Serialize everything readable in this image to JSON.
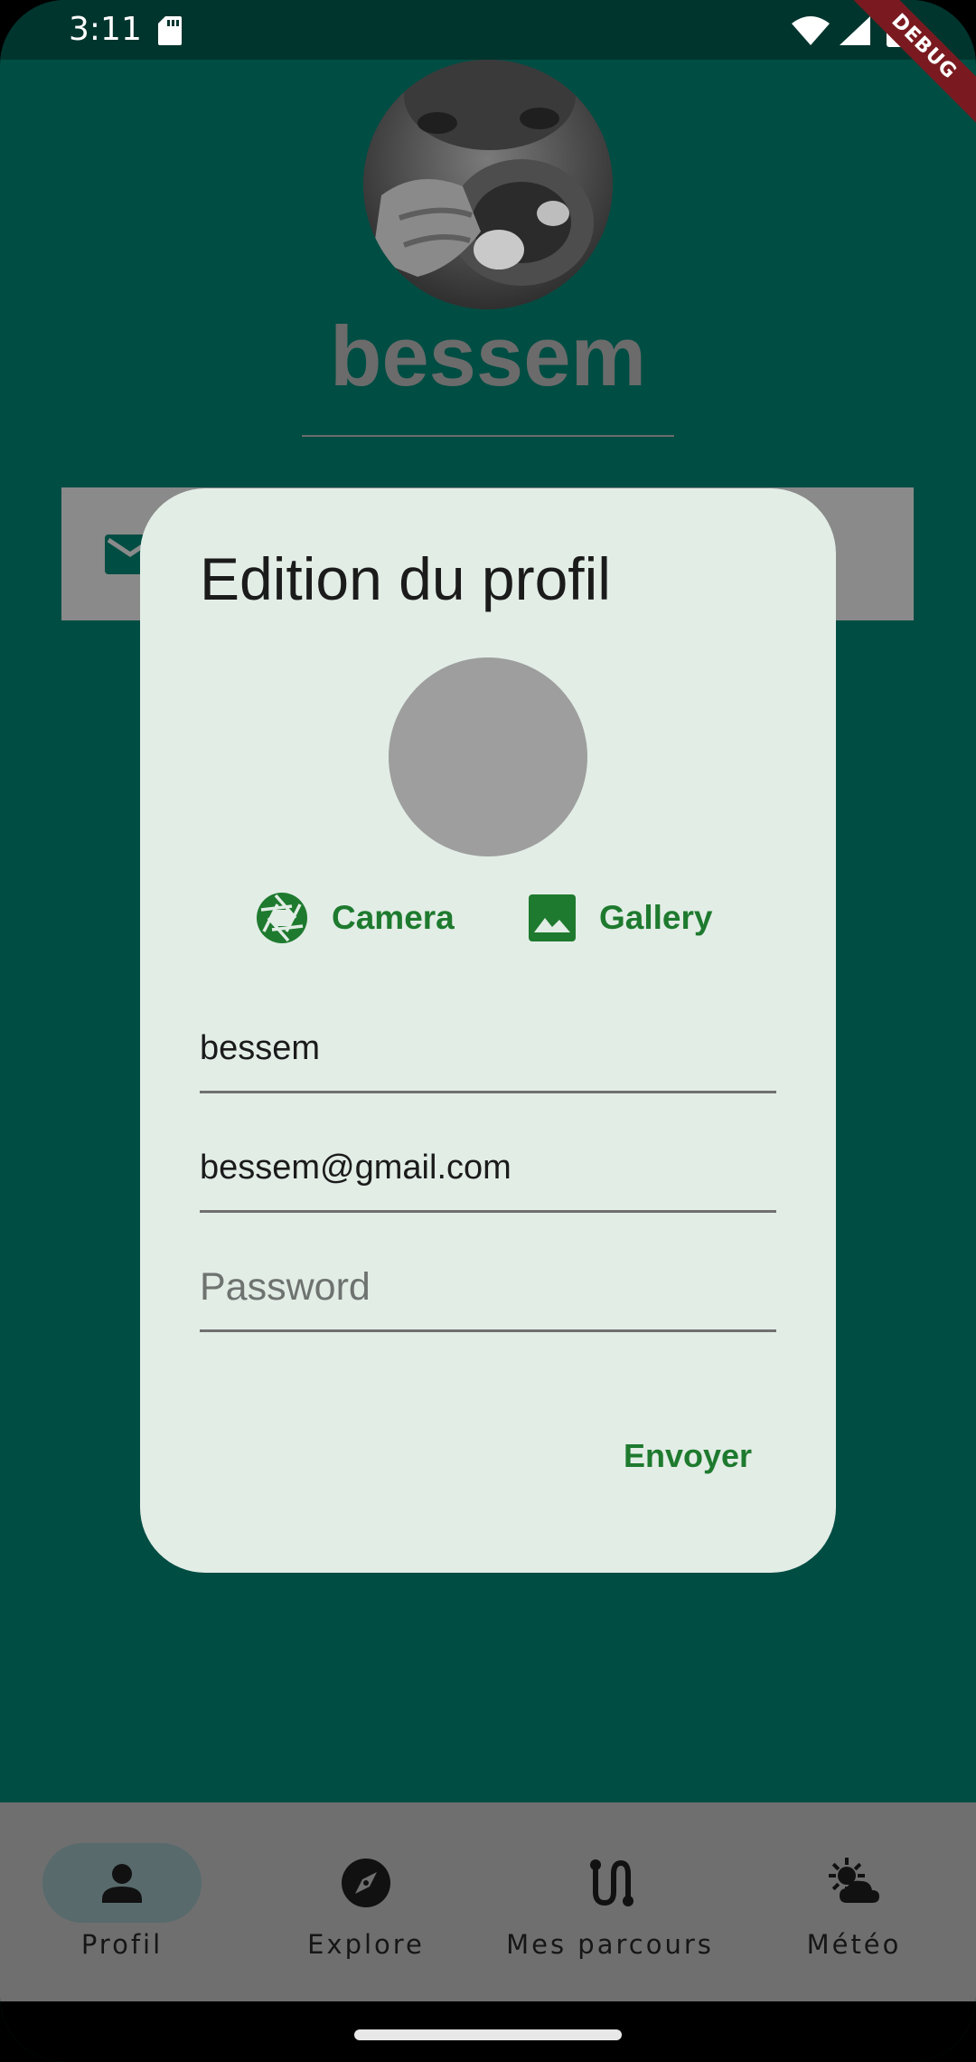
{
  "status_bar": {
    "time": "3:11"
  },
  "debug_banner": "DEBUG",
  "profile": {
    "name": "bessem"
  },
  "dialog": {
    "title": "Edition du profil",
    "camera_label": "Camera",
    "gallery_label": "Gallery",
    "name_value": "bessem",
    "email_value": "bessem@gmail.com",
    "password_placeholder": "Password",
    "password_value": "",
    "send_label": "Envoyer"
  },
  "bottom_nav": {
    "selected": "Profil",
    "items": [
      {
        "label": "Profil",
        "icon": "person-icon"
      },
      {
        "label": "Explore",
        "icon": "compass-icon"
      },
      {
        "label": "Mes parcours",
        "icon": "route-icon"
      },
      {
        "label": "Météo",
        "icon": "weather-icon"
      }
    ]
  },
  "colors": {
    "app_background": "#004D43",
    "status_bar": "#00352E",
    "dialog_background": "#E2EDE6",
    "accent": "#1E7A2E",
    "nav_background": "#6F6F6F"
  }
}
